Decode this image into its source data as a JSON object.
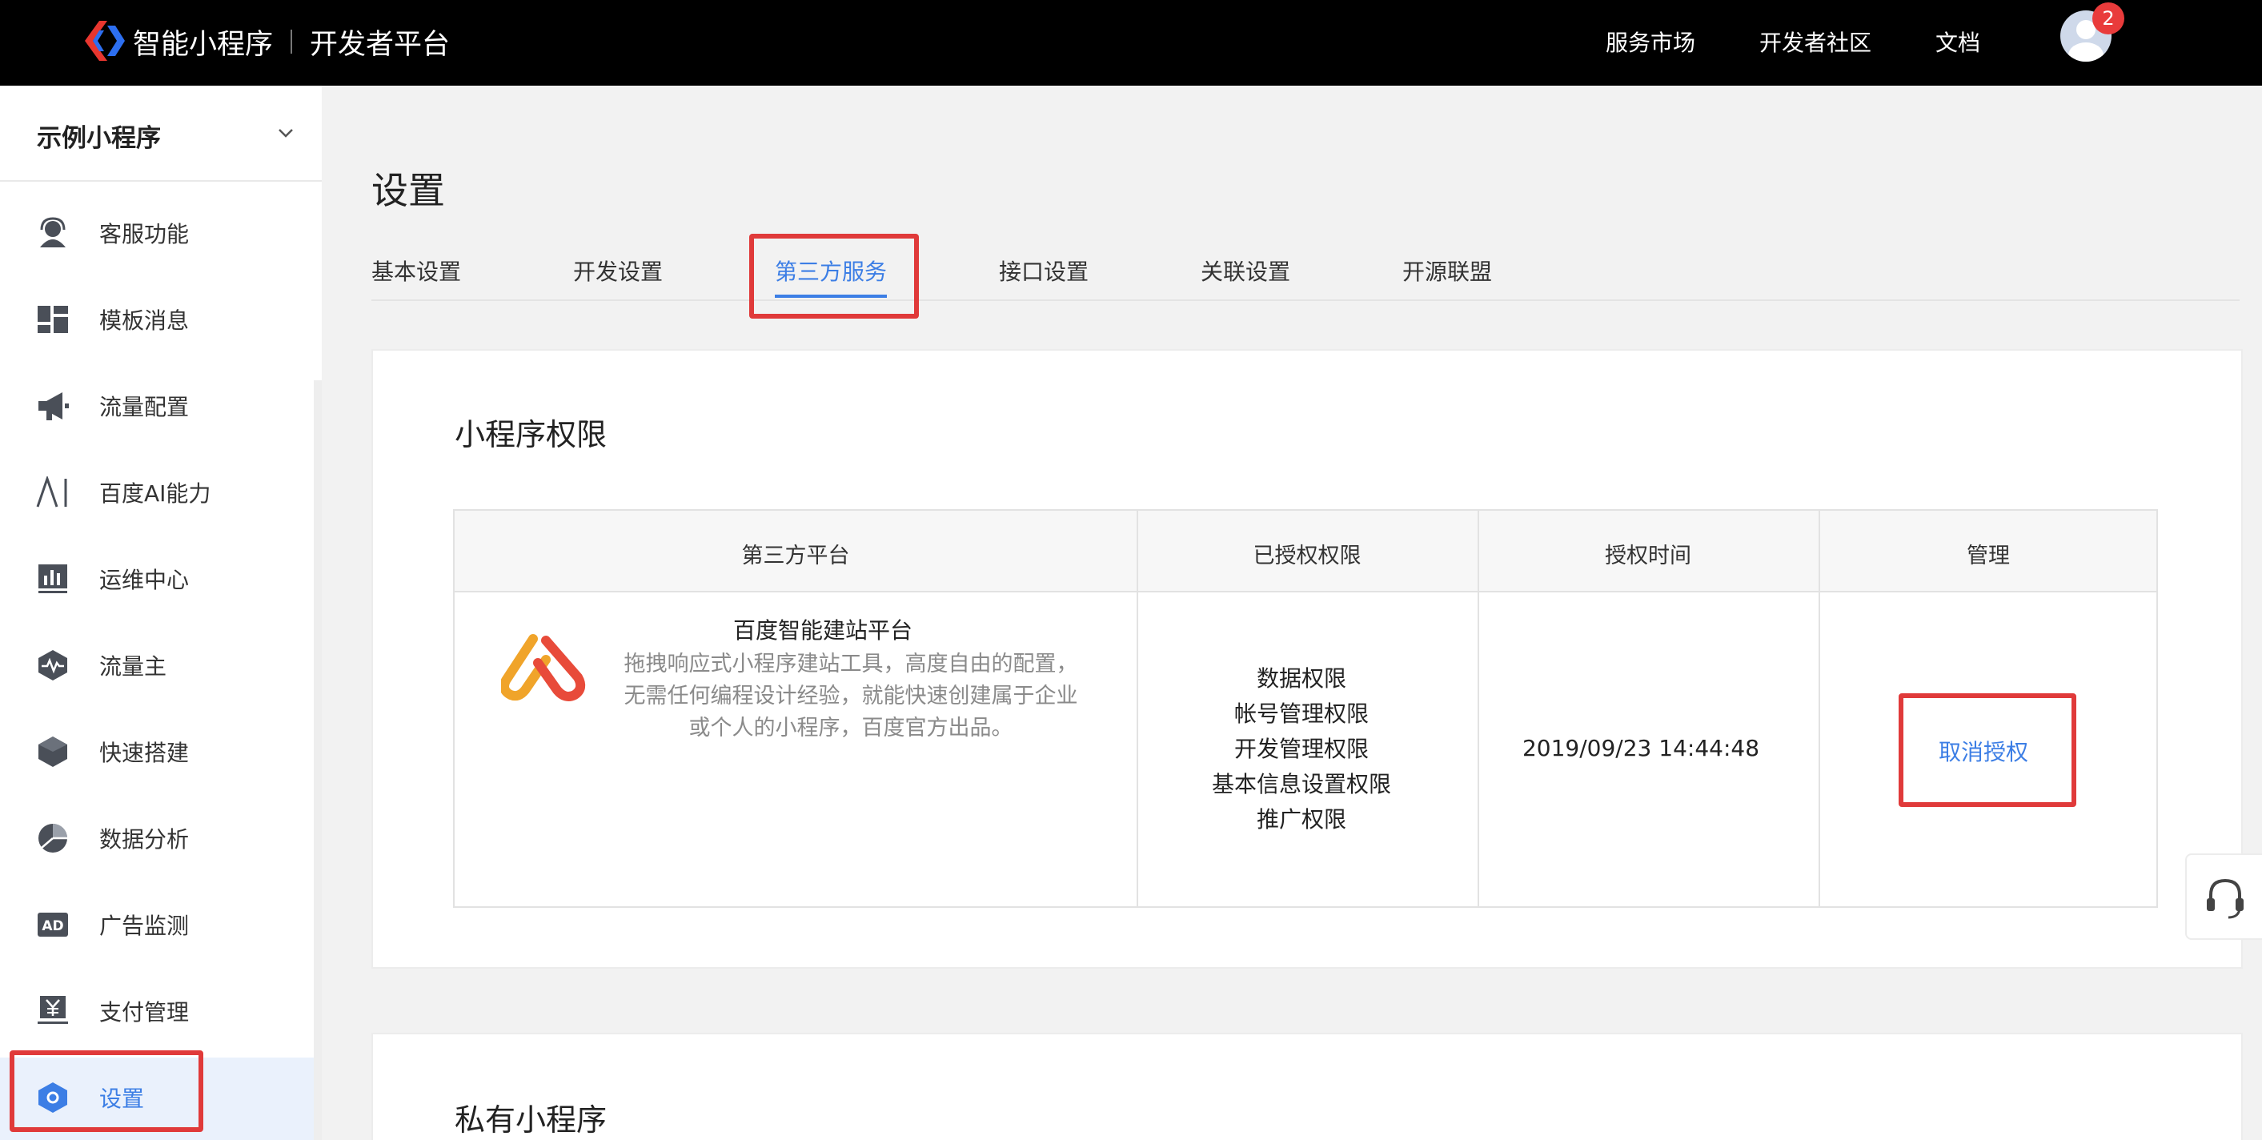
{
  "header": {
    "brand": "智能小程序",
    "platform": "开发者平台",
    "nav": [
      "服务市场",
      "开发者社区",
      "文档"
    ],
    "notification_count": "2",
    "colors": {
      "bar": "#000000",
      "badge": "#e93b3b"
    }
  },
  "sidebar": {
    "app_name": "示例小程序",
    "items": [
      {
        "label": "客服功能",
        "icon": "customer-service-icon"
      },
      {
        "label": "模板消息",
        "icon": "template-grid-icon"
      },
      {
        "label": "流量配置",
        "icon": "megaphone-icon"
      },
      {
        "label": "百度AI能力",
        "icon": "ai-icon"
      },
      {
        "label": "运维中心",
        "icon": "bar-chart-icon"
      },
      {
        "label": "流量主",
        "icon": "pulse-hexagon-icon"
      },
      {
        "label": "快速搭建",
        "icon": "cube-icon"
      },
      {
        "label": "数据分析",
        "icon": "pie-chart-icon"
      },
      {
        "label": "广告监测",
        "icon": "ad-icon"
      },
      {
        "label": "支付管理",
        "icon": "yen-icon"
      },
      {
        "label": "设置",
        "icon": "settings-hexagon-icon",
        "active": true
      }
    ]
  },
  "main": {
    "title": "设置",
    "tabs": [
      "基本设置",
      "开发设置",
      "第三方服务",
      "接口设置",
      "关联设置",
      "开源联盟"
    ],
    "active_tab": "第三方服务",
    "accent_color": "#3c7ee5",
    "highlight_color": "#e03a3a"
  },
  "permissions_card": {
    "title": "小程序权限",
    "columns": [
      "第三方平台",
      "已授权权限",
      "授权时间",
      "管理"
    ],
    "row": {
      "platform_name": "百度智能建站平台",
      "platform_desc": "拖拽响应式小程序建站工具，高度自由的配置，无需任何编程设计经验，就能快速创建属于企业或个人的小程序，百度官方出品。",
      "permissions": [
        "数据权限",
        "帐号管理权限",
        "开发管理权限",
        "基本信息设置权限",
        "推广权限"
      ],
      "auth_time": "2019/09/23 14:44:48",
      "action": "取消授权"
    }
  },
  "private_card": {
    "title": "私有小程序"
  }
}
